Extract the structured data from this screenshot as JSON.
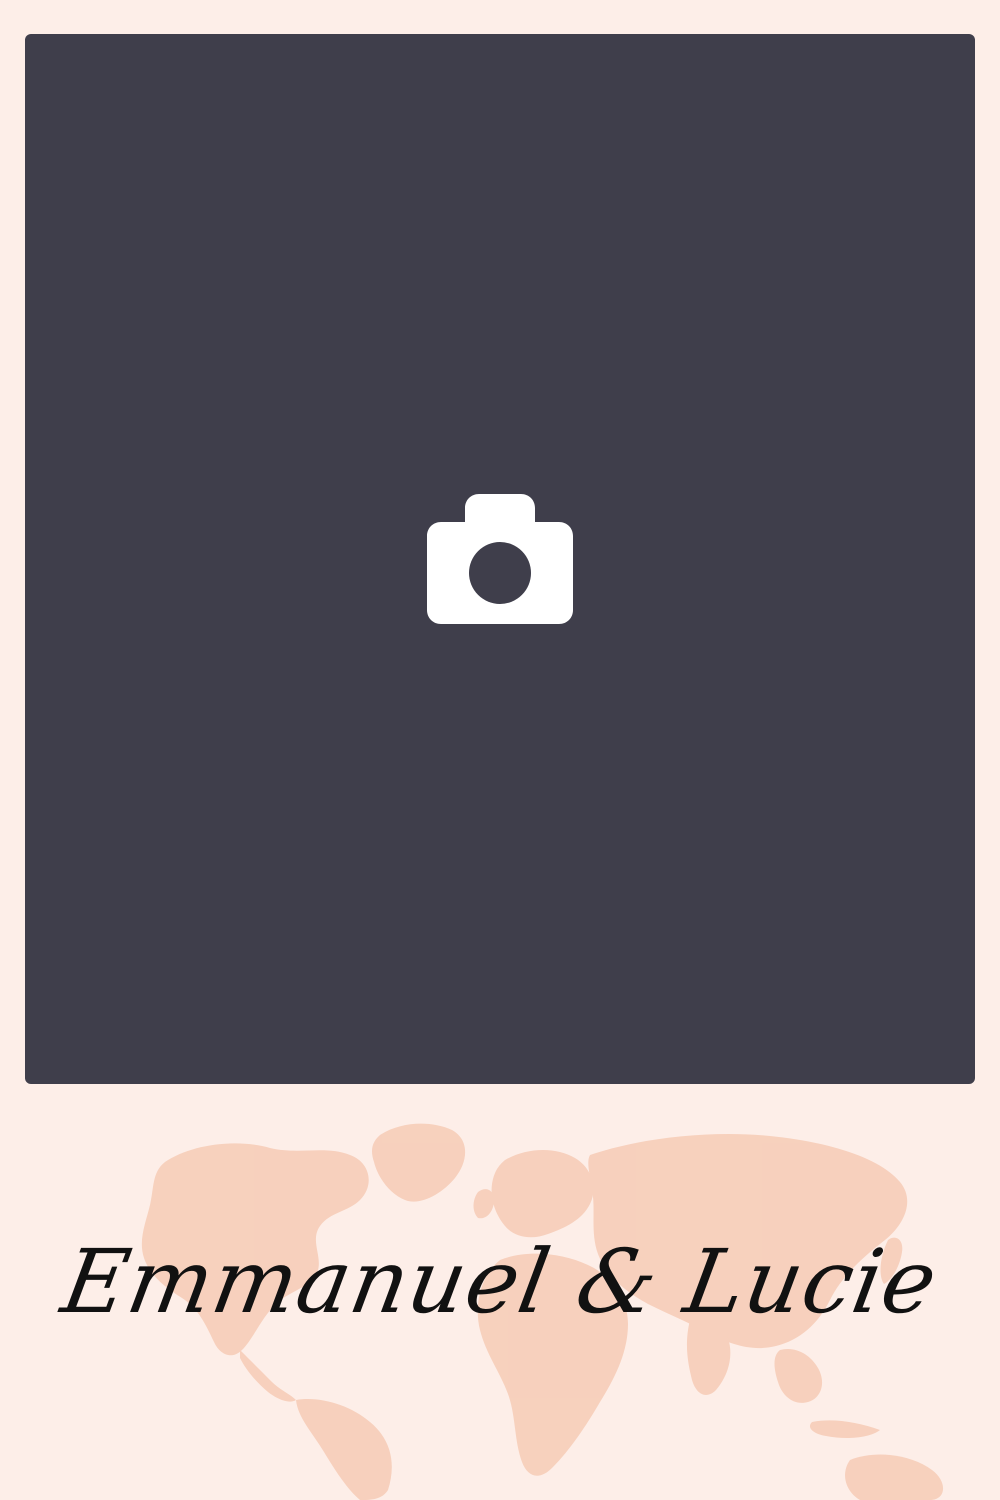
{
  "photo": {
    "icon": "camera-icon",
    "background_color": "#3f3e4b",
    "icon_color": "#ffffff"
  },
  "background": {
    "color": "#fdeee8",
    "decoration": "world-map",
    "map_color": "#f7cfbb"
  },
  "title": {
    "names": "Emmanuel & Lucie",
    "color": "#111111"
  }
}
